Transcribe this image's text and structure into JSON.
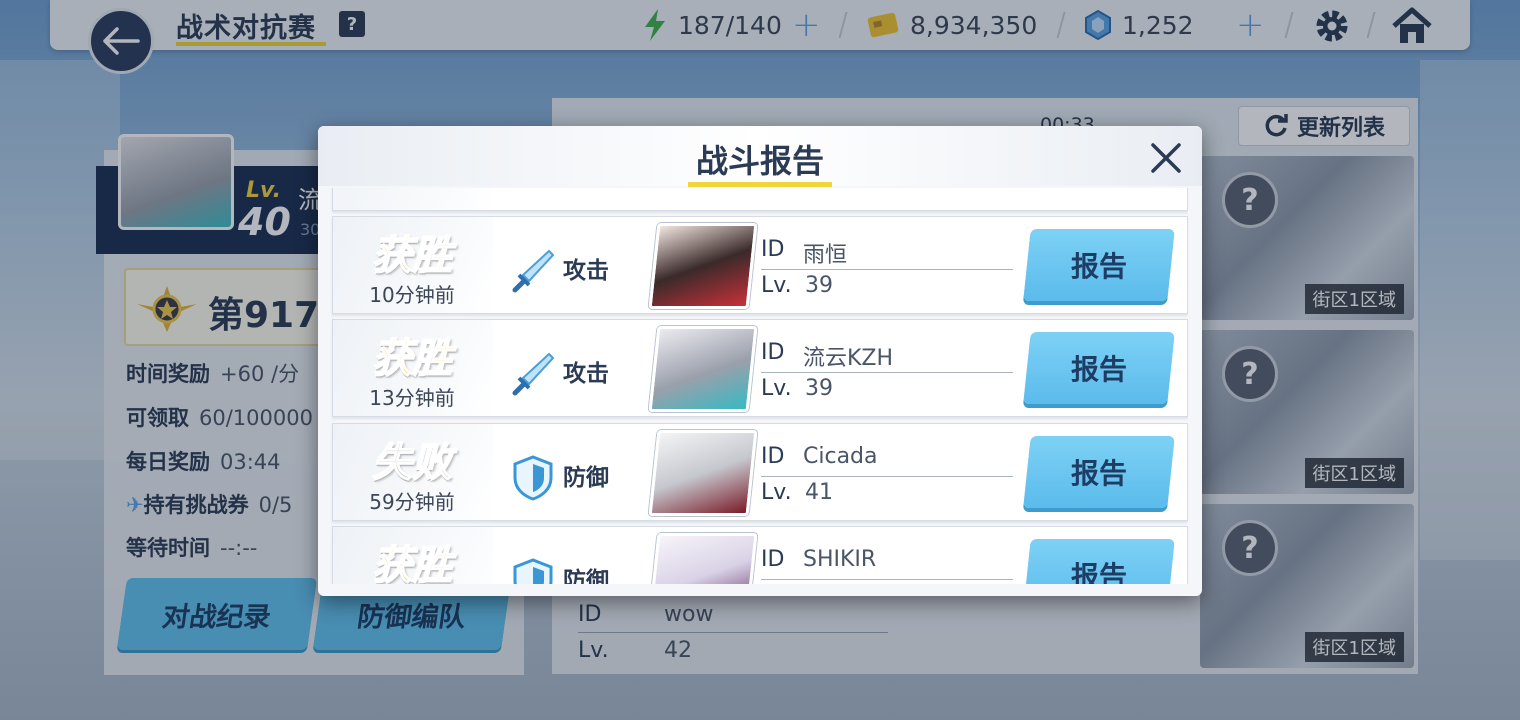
{
  "header": {
    "title": "战术对抗赛",
    "help": "?",
    "stamina": "187/140",
    "credits": "8,934,350",
    "gems": "1,252"
  },
  "player": {
    "lv_prefix": "Lv.",
    "level": "40",
    "name": "流",
    "id_partial": "30",
    "rank": "第917"
  },
  "stats": {
    "time_reward_label": "时间奖励",
    "time_reward_value": "+60 /分",
    "claimable_label": "可领取",
    "claimable_value": "60/100000",
    "daily_reward_label": "每日奖励",
    "daily_reward_value": "03:44",
    "tickets_label": "持有挑战券",
    "tickets_value": "0/5",
    "wait_label": "等待时间",
    "wait_value": "--:--"
  },
  "left_buttons": {
    "battle_record": "对战纪录",
    "defense_team": "防御编队"
  },
  "opponents": {
    "refresh_label": "更新列表",
    "timer": "00:33",
    "area_label": "街区1区域",
    "bottom_id_label": "ID",
    "bottom_id_value": "wow",
    "bottom_lv_label": "Lv.",
    "bottom_lv_value": "42"
  },
  "modal": {
    "title": "战斗报告",
    "id_label": "ID",
    "lv_label": "Lv.",
    "reports": [
      {
        "result": "获胜",
        "time": "10分钟前",
        "type": "攻击",
        "id": "雨恒",
        "lv": "39",
        "button": "报告"
      },
      {
        "result": "获胜",
        "time": "13分钟前",
        "type": "攻击",
        "id": "流云KZH",
        "lv": "39",
        "button": "报告"
      },
      {
        "result": "失败",
        "time": "59分钟前",
        "type": "防御",
        "id": "Cicada",
        "lv": "41",
        "button": "报告"
      },
      {
        "result": "获胜",
        "time": "",
        "type": "防御",
        "id": "SHIKIR",
        "lv": "",
        "button": "报告"
      }
    ]
  },
  "colors": {
    "accent_blue": "#5bbbeb",
    "title_underline": "#f1d43b",
    "win_gold": "#f3c12a",
    "navy": "#2b3a55"
  }
}
